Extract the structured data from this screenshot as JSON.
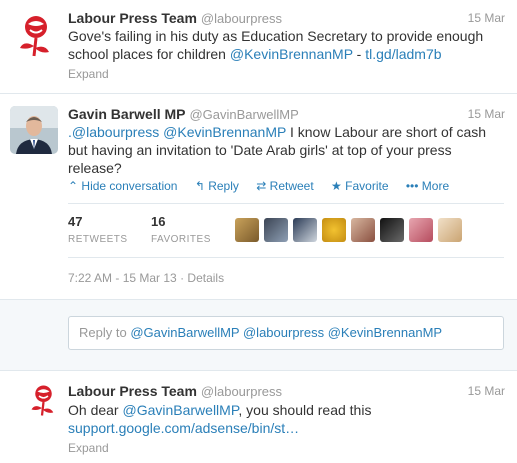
{
  "tweets": [
    {
      "name": "Labour Press Team",
      "handle": "@labourpress",
      "date": "15 Mar",
      "text_before": "Gove's failing in his duty as Education Secretary to provide enough school places for children ",
      "mention": "@KevinBrennanMP",
      "text_mid": " - ",
      "url": "tl.gd/ladm7b",
      "expand": "Expand"
    },
    {
      "name": "Gavin Barwell MP",
      "handle": "@GavinBarwellMP",
      "date": "15 Mar",
      "mention1": ".@labourpress",
      "mention2": "@KevinBrennanMP",
      "text": " I know Labour are short of cash but having an invitation to 'Date Arab girls' at top of your press release?",
      "actions": {
        "hide": "Hide conversation",
        "reply": "Reply",
        "retweet": "Retweet",
        "favorite": "Favorite",
        "more": "More"
      },
      "retweets_count": "47",
      "retweets_label": "RETWEETS",
      "favorites_count": "16",
      "favorites_label": "FAVORITES",
      "timestamp": "7:22 AM - 15 Mar 13",
      "details": "Details"
    },
    {
      "name": "Labour Press Team",
      "handle": "@labourpress",
      "date": "15 Mar",
      "text_before": "Oh dear ",
      "mention": "@GavinBarwellMP",
      "text_after": ", you should read this",
      "url": "support.google.com/adsense/bin/st…",
      "expand": "Expand"
    }
  ],
  "reply": {
    "prefix": "Reply to ",
    "mention1": "@GavinBarwellMP",
    "mention2": "@labourpress",
    "mention3": "@KevinBrennanMP"
  },
  "favoriters_icons": [
    "avatar-1",
    "avatar-2",
    "avatar-3",
    "avatar-4",
    "avatar-5",
    "avatar-6",
    "avatar-7",
    "avatar-8"
  ],
  "colors": {
    "link": "#2a7fb8",
    "muted": "#999999",
    "labour_red": "#d6202b"
  }
}
